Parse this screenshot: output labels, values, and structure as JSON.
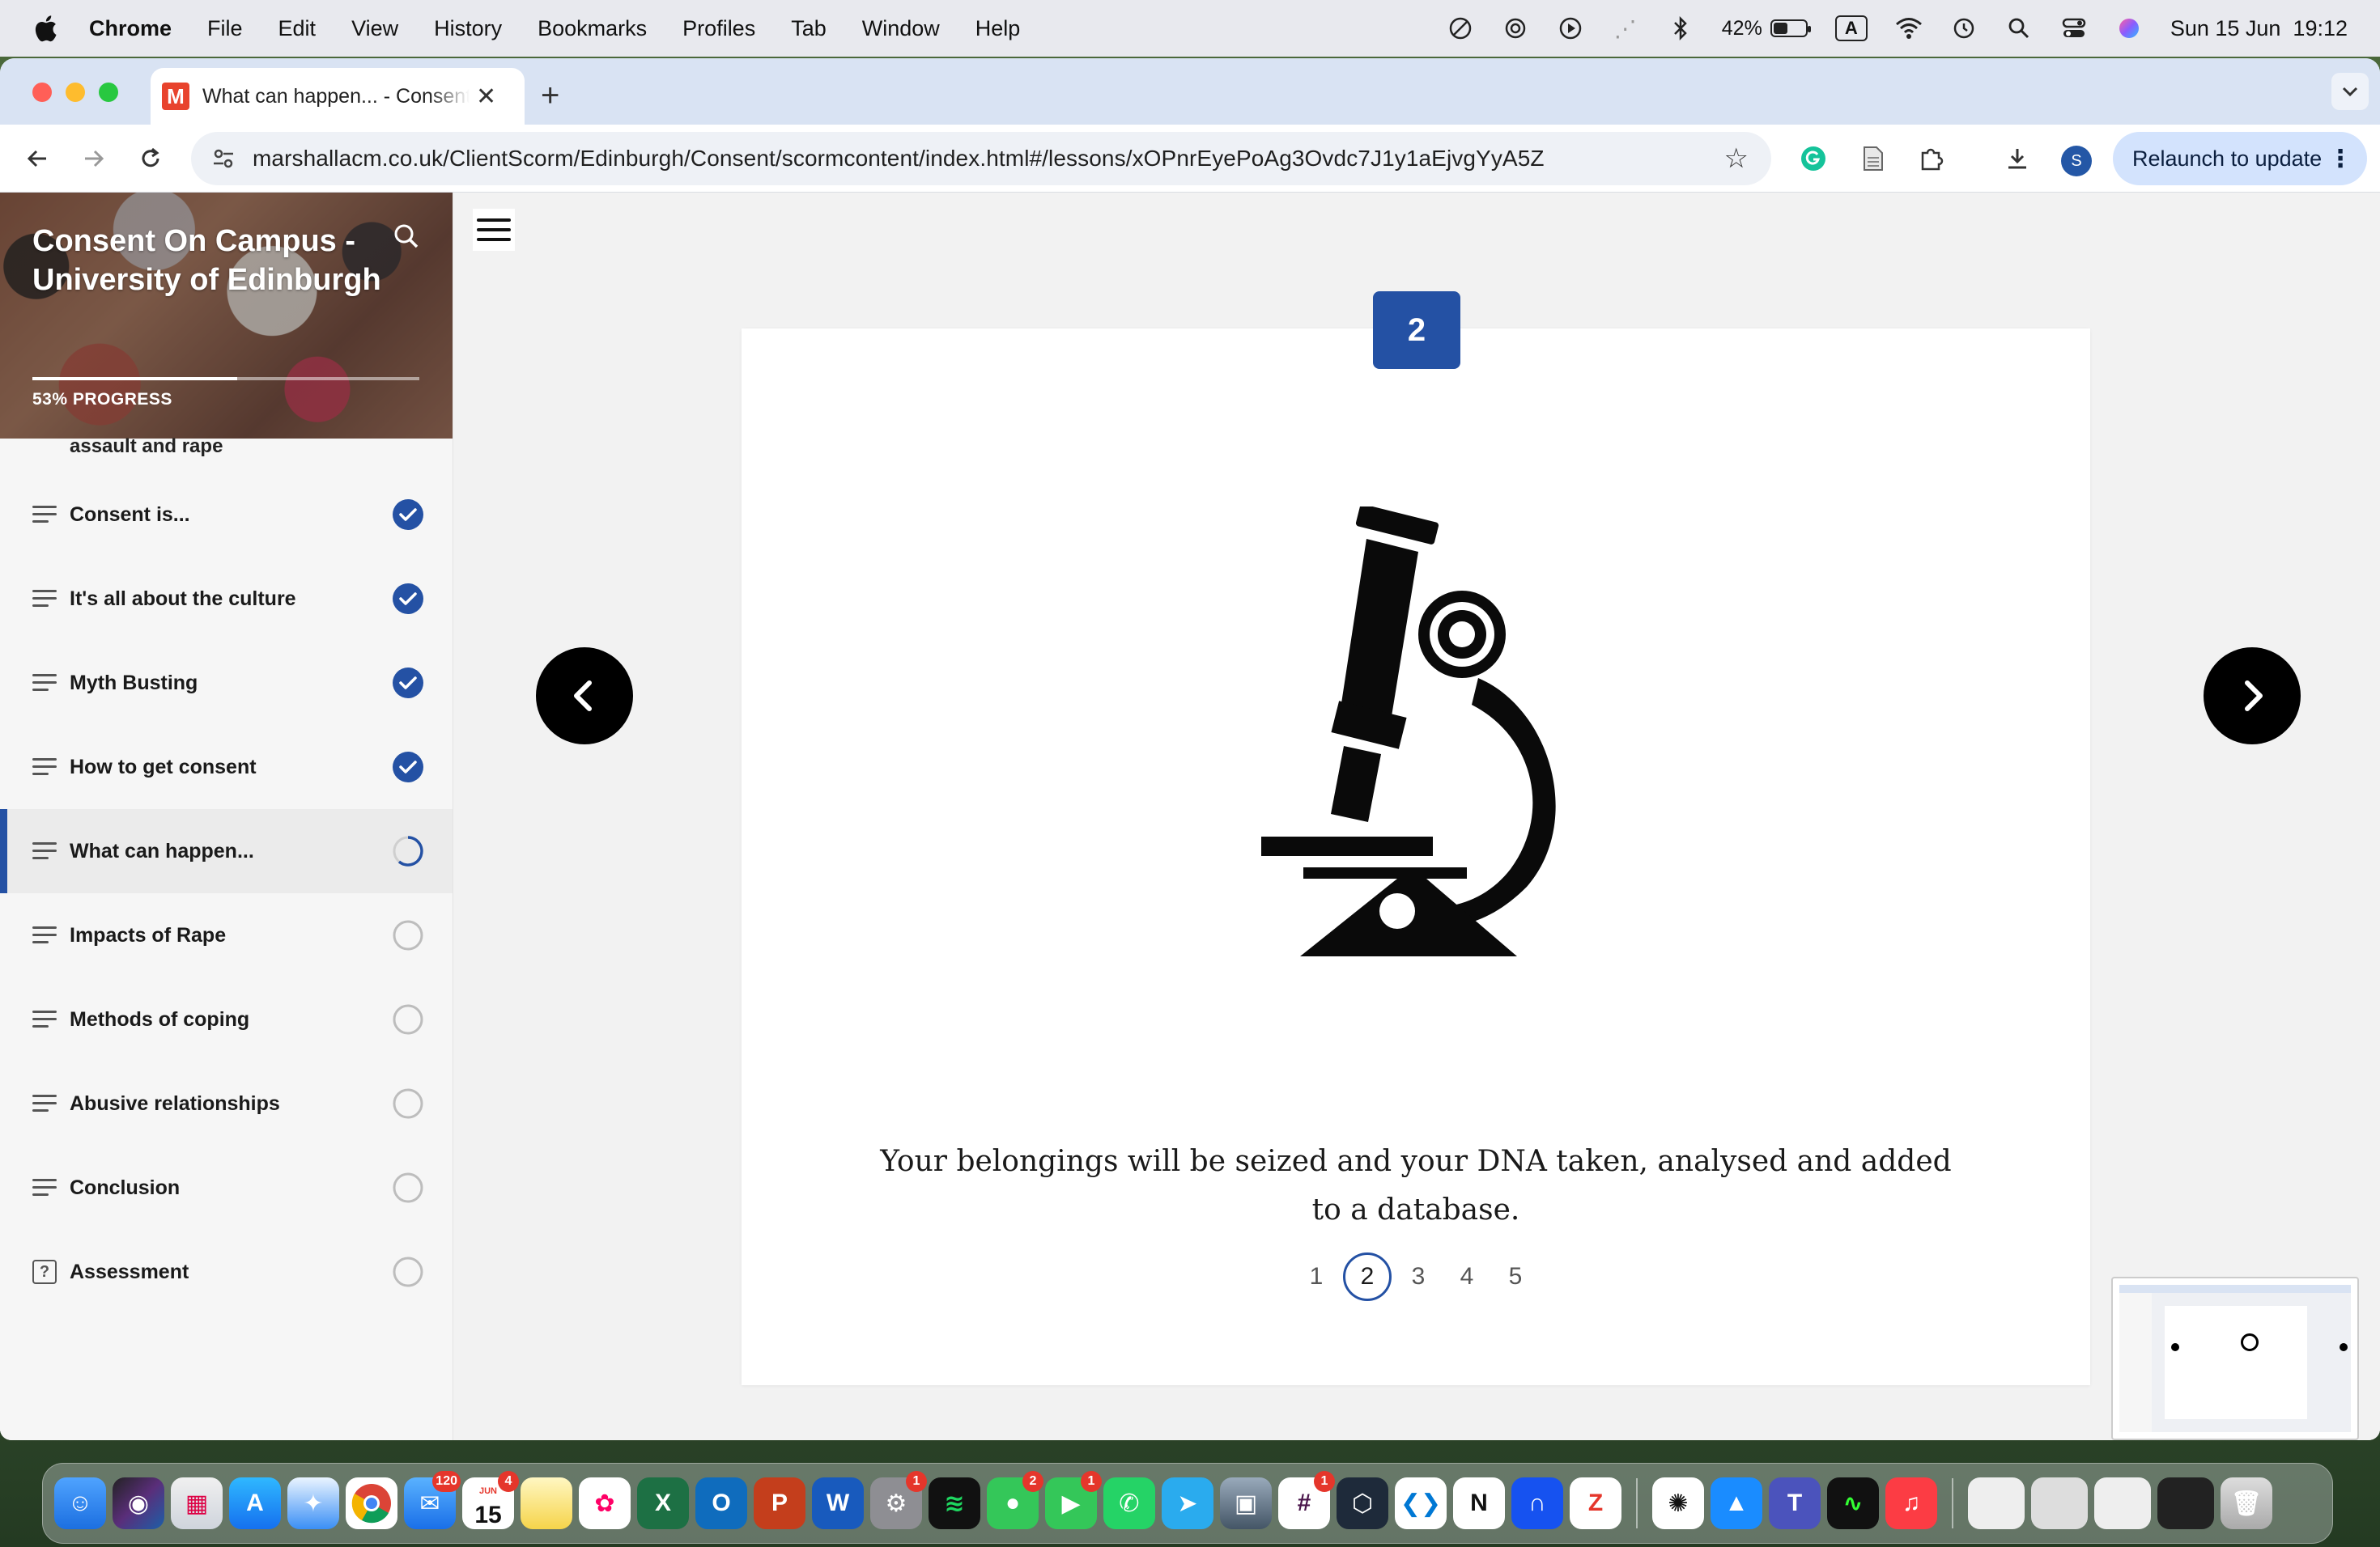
{
  "menubar": {
    "items": [
      "Chrome",
      "File",
      "Edit",
      "View",
      "History",
      "Bookmarks",
      "Profiles",
      "Tab",
      "Window",
      "Help"
    ],
    "battery_percent": "42%",
    "battery_level": 0.42,
    "input_source": "A",
    "datetime": "Sun 15 Jun  19:12"
  },
  "browser": {
    "tab_title": "What can happen... - Consent On Campus",
    "favicon_letter": "M",
    "url": "marshallacm.co.uk/ClientScorm/Edinburgh/Consent/scormcontent/index.html#/lessons/xOPnrEyePoAg3Ovdc7J1y1aEjvgYyA5Z",
    "profile_initial": "S",
    "relaunch_label": "Relaunch to update",
    "page_load_progress": 0.5
  },
  "course": {
    "title": "Consent On Campus - University of Edinburgh",
    "progress_label": "53% PROGRESS",
    "progress_value": 0.53,
    "partial_lesson_text": "assault and rape",
    "lessons": [
      {
        "label": "Consent is...",
        "status": "complete",
        "icon": "list-icon"
      },
      {
        "label": "It's all about the culture",
        "status": "complete",
        "icon": "list-icon"
      },
      {
        "label": "Myth Busting",
        "status": "complete",
        "icon": "list-icon"
      },
      {
        "label": "How to get consent",
        "status": "complete",
        "icon": "list-icon"
      },
      {
        "label": "What can happen...",
        "status": "in-progress",
        "icon": "list-icon"
      },
      {
        "label": "Impacts of Rape",
        "status": "not-started",
        "icon": "list-icon"
      },
      {
        "label": "Methods of coping",
        "status": "not-started",
        "icon": "list-icon"
      },
      {
        "label": "Abusive relationships",
        "status": "not-started",
        "icon": "list-icon"
      },
      {
        "label": "Conclusion",
        "status": "not-started",
        "icon": "list-icon"
      },
      {
        "label": "Assessment",
        "status": "not-started",
        "icon": "quiz-icon"
      }
    ]
  },
  "slide": {
    "badge": "2",
    "illustration": "microscope-icon",
    "caption": "Your belongings will be seized and your DNA taken, analysed and added to a database.",
    "pages": [
      "1",
      "2",
      "3",
      "4",
      "5"
    ],
    "current_page": "2"
  },
  "dock": {
    "mail_badge": "120",
    "calendar_month": "JUN",
    "calendar_day": "15",
    "calendar_badge": "4",
    "settings_badge": "1",
    "messages_badge": "2",
    "facetime_badge": "1",
    "slack_badge": "1"
  },
  "colors": {
    "accent": "#2451a4",
    "menubar_bg": "#e8e9ee",
    "tabstrip_bg": "#d9e3f3",
    "relaunch_bg": "#d3e3fd"
  }
}
